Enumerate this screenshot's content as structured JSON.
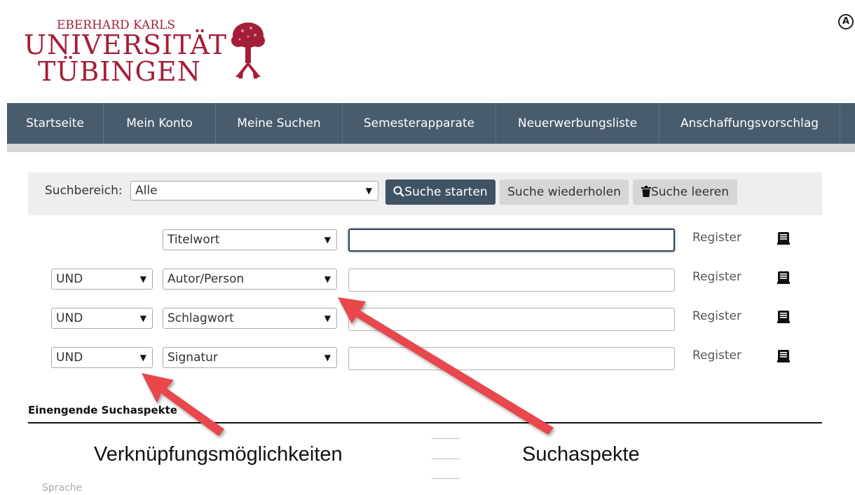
{
  "header": {
    "logo_line1": "EBERHARD KARLS",
    "logo_line2": "UNIVERSITÄT",
    "logo_line3": "TÜBINGEN",
    "corner_icon_letter": "A"
  },
  "nav": {
    "items": [
      {
        "label": "Startseite"
      },
      {
        "label": "Mein Konto"
      },
      {
        "label": "Meine Suchen"
      },
      {
        "label": "Semesterapparate"
      },
      {
        "label": "Neuerwerbungsliste"
      },
      {
        "label": "Anschaffungsvorschlag"
      }
    ]
  },
  "search_bar": {
    "scope_label": "Suchbereich:",
    "scope_value": "Alle",
    "start_button": "Suche starten",
    "repeat_button": "Suche wiederholen",
    "clear_button": "Suche leeren"
  },
  "search_rows": [
    {
      "operator": "",
      "field": "Titelwort",
      "value": "",
      "register": "Register"
    },
    {
      "operator": "UND",
      "field": "Autor/Person",
      "value": "",
      "register": "Register"
    },
    {
      "operator": "UND",
      "field": "Schlagwort",
      "value": "",
      "register": "Register"
    },
    {
      "operator": "UND",
      "field": "Signatur",
      "value": "",
      "register": "Register"
    }
  ],
  "section": {
    "title": "Einengende Suchaspekte",
    "faint_label": "Sprache"
  },
  "annotations": {
    "left": "Verknüpfungsmöglichkeiten",
    "right": "Suchaspekte"
  },
  "colors": {
    "brand": "#a51e37",
    "nav_bg": "#485c6c",
    "primary_button": "#3f5363",
    "arrow": "#e8474b"
  }
}
